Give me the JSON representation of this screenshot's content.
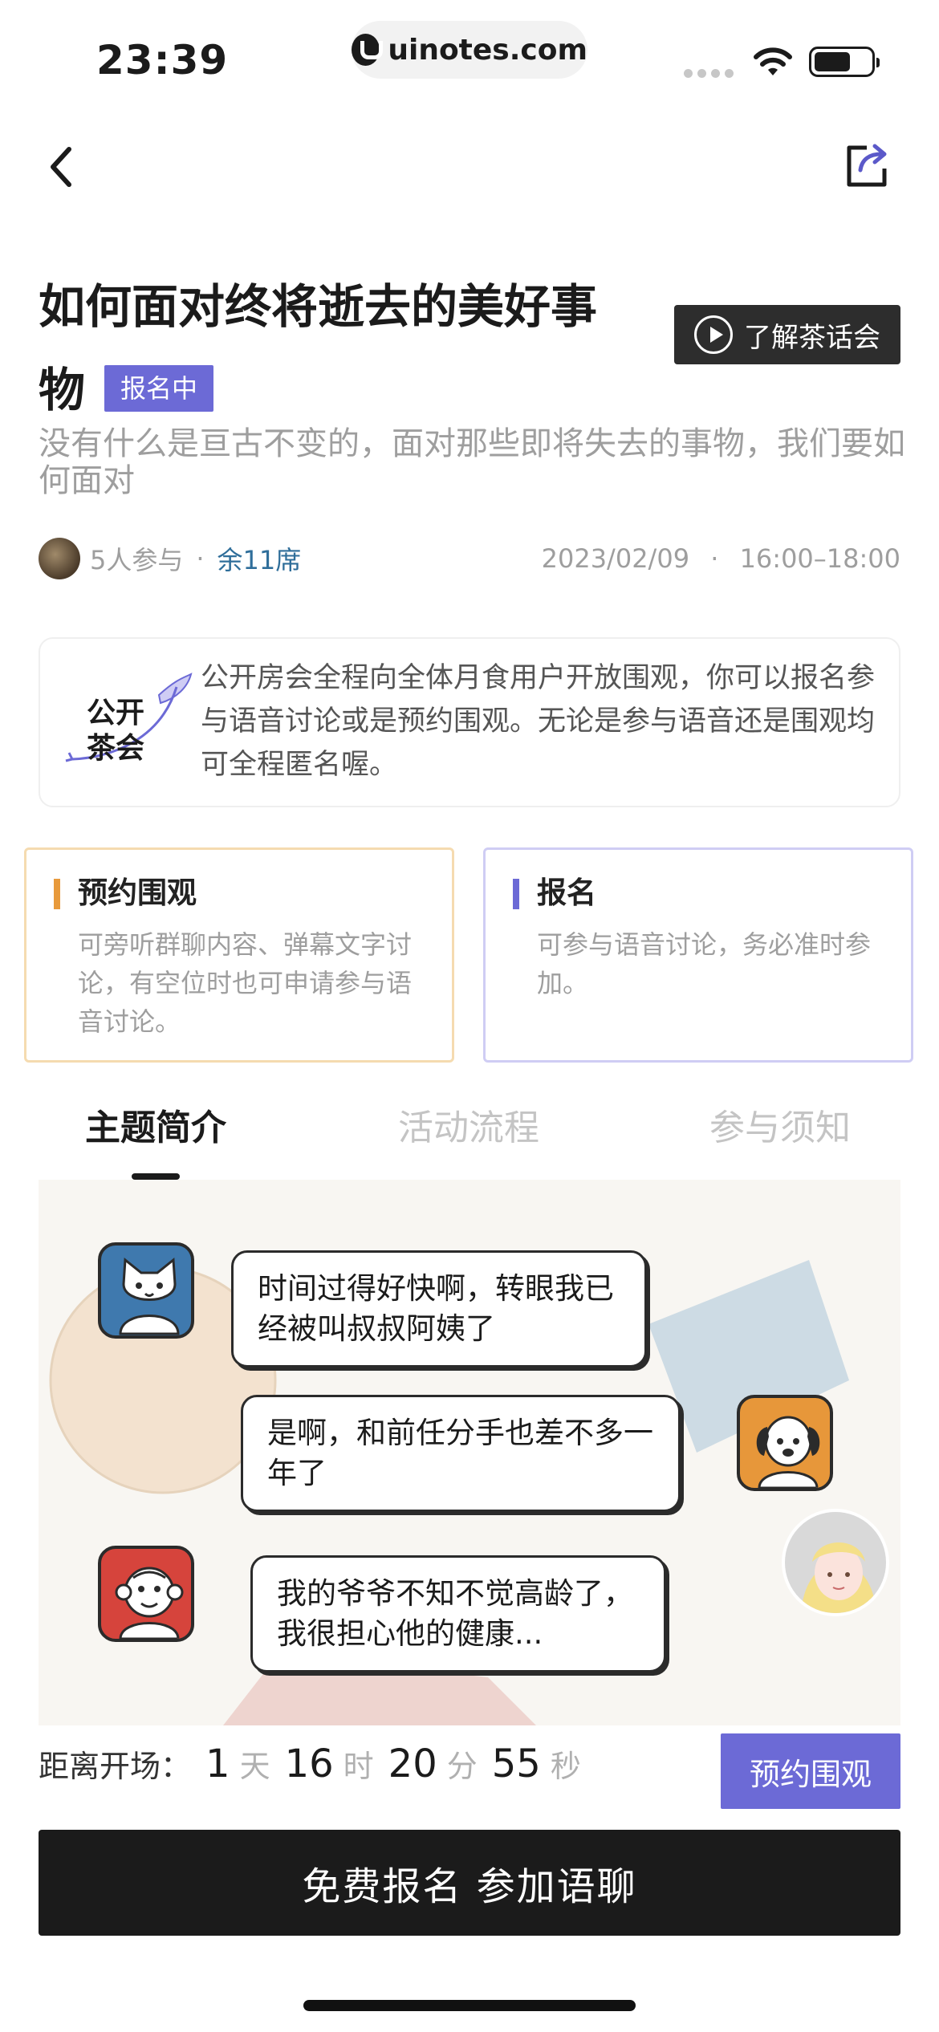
{
  "status_bar": {
    "time": "23:39",
    "url": "uinotes.com"
  },
  "event": {
    "title": "如何面对终将逝去的美好事物",
    "badge": "报名中",
    "teaser_button": "了解茶话会",
    "description": "没有什么是亘古不变的，面对那些即将失去的事物，我们要如何面对",
    "participants": "5人参与",
    "seats_left": "余11席",
    "date": "2023/02/09",
    "time_range": "16:00–18:00",
    "separator": "·"
  },
  "info_box": {
    "logo_text_line1": "公开",
    "logo_text_line2": "茶会",
    "text": "公开房会全程向全体月食用户开放围观，你可以报名参与语音讨论或是预约围观。无论是参与语音还是围观均可全程匿名喔。"
  },
  "options": [
    {
      "title": "预约围观",
      "desc": "可旁听群聊内容、弹幕文字讨论，有空位时也可申请参与语音讨论。"
    },
    {
      "title": "报名",
      "desc": "可参与语音讨论，务必准时参加。"
    }
  ],
  "tabs": [
    {
      "label": "主题简介",
      "active": true
    },
    {
      "label": "活动流程",
      "active": false
    },
    {
      "label": "参与须知",
      "active": false
    }
  ],
  "illustration": {
    "chats": [
      {
        "speaker": "cat-avatar",
        "text": "时间过得好快啊，转眼我已经被叫叔叔阿姨了"
      },
      {
        "speaker": "dog-avatar",
        "text": "是啊，和前任分手也差不多一年了"
      },
      {
        "speaker": "monkey-avatar",
        "text": "我的爷爷不知不觉高龄了，我很担心他的健康..."
      }
    ]
  },
  "countdown": {
    "label": "距离开场：",
    "days": "1",
    "days_unit": "天",
    "hours": "16",
    "hours_unit": "时",
    "minutes": "20",
    "minutes_unit": "分",
    "seconds": "55",
    "seconds_unit": "秒"
  },
  "buttons": {
    "watch": "预约围观",
    "signup": "免费报名 参加语聊"
  },
  "colors": {
    "accent": "#6c6ad6",
    "orange": "#e89a3c",
    "dark": "#1b1b1b",
    "seats": "#2f6e9a"
  }
}
